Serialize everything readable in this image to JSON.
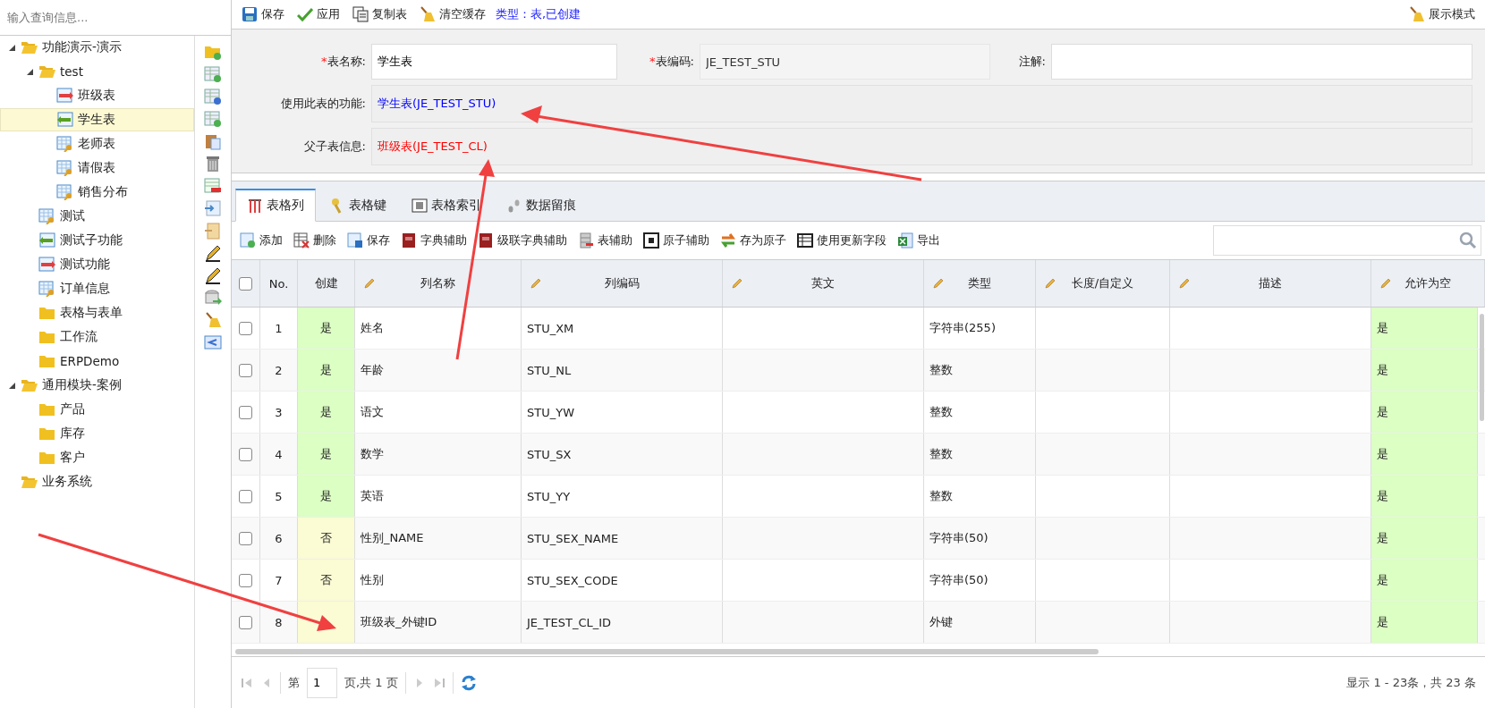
{
  "sidebar": {
    "search": {
      "placeholder": "输入查询信息..."
    },
    "tree": [
      {
        "label": "功能演示-演示",
        "kind": "folder",
        "expanded": true,
        "selected": false,
        "children": [
          {
            "label": "test",
            "kind": "folder",
            "expanded": true,
            "selected": false,
            "children": [
              {
                "label": "班级表",
                "kind": "parent-table",
                "selected": false
              },
              {
                "label": "学生表",
                "kind": "child-table",
                "selected": true
              },
              {
                "label": "老师表",
                "kind": "table",
                "selected": false
              },
              {
                "label": "请假表",
                "kind": "table",
                "selected": false
              },
              {
                "label": "销售分布",
                "kind": "table",
                "selected": false
              }
            ]
          },
          {
            "label": "测试",
            "kind": "table",
            "selected": false
          },
          {
            "label": "测试子功能",
            "kind": "child-table",
            "selected": false
          },
          {
            "label": "测试功能",
            "kind": "parent-table",
            "selected": false
          },
          {
            "label": "订单信息",
            "kind": "table",
            "selected": false
          },
          {
            "label": "表格与表单",
            "kind": "folder",
            "expanded": false,
            "selected": false
          },
          {
            "label": "工作流",
            "kind": "folder",
            "expanded": false,
            "selected": false
          },
          {
            "label": "ERPDemo",
            "kind": "folder",
            "expanded": false,
            "selected": false
          }
        ]
      },
      {
        "label": "通用模块-案例",
        "kind": "folder",
        "expanded": true,
        "selected": false,
        "children": [
          {
            "label": "产品",
            "kind": "folder",
            "expanded": false,
            "selected": false
          },
          {
            "label": "库存",
            "kind": "folder",
            "expanded": false,
            "selected": false
          },
          {
            "label": "客户",
            "kind": "folder",
            "expanded": false,
            "selected": false
          }
        ]
      },
      {
        "label": "业务系统",
        "kind": "folder",
        "expanded": true,
        "selected": false
      }
    ]
  },
  "toolbar": {
    "buttons": [
      {
        "label": "保存",
        "kind": "save"
      },
      {
        "label": "应用",
        "kind": "apply"
      },
      {
        "label": "复制表",
        "kind": "copy"
      },
      {
        "label": "清空缓存",
        "kind": "clear"
      }
    ],
    "status": "类型：表,已创建",
    "mode_button": "展示模式"
  },
  "form": {
    "fields": [
      {
        "required_mark": "*",
        "label": "表名称:",
        "value": "学生表",
        "readonly": false
      },
      {
        "required_mark": "*",
        "label": "表编码:",
        "value": "JE_TEST_STU",
        "readonly": true
      },
      {
        "label": "注解:"
      }
    ],
    "info": [
      {
        "label": "使用此表的功能:",
        "value": "学生表(JE_TEST_STU)",
        "color": "#0000ff"
      },
      {
        "label": "父子表信息:",
        "value": "班级表(JE_TEST_CL)",
        "color": "#ff0000"
      }
    ]
  },
  "tabs": [
    {
      "label": "表格列",
      "selected": true,
      "kind": "columns"
    },
    {
      "label": "表格键",
      "selected": false,
      "kind": "keys"
    },
    {
      "label": "表格索引",
      "selected": false,
      "kind": "index"
    },
    {
      "label": "数据留痕",
      "selected": false,
      "kind": "trace"
    }
  ],
  "grid_toolbar": [
    {
      "label": "添加",
      "kind": "add"
    },
    {
      "label": "删除",
      "kind": "delete"
    },
    {
      "label": "保存",
      "kind": "save"
    },
    {
      "label": "字典辅助",
      "kind": "book"
    },
    {
      "label": "级联字典辅助",
      "kind": "book"
    },
    {
      "label": "表辅助",
      "kind": "db"
    },
    {
      "label": "原子辅助",
      "kind": "atom"
    },
    {
      "label": "存为原子",
      "kind": "swap"
    },
    {
      "label": "使用更新字段",
      "kind": "grid"
    },
    {
      "label": "导出",
      "kind": "excel"
    }
  ],
  "table": {
    "all_checked": false,
    "columns": [
      {
        "label": "No.",
        "editable": false
      },
      {
        "label": "创建",
        "editable": false
      },
      {
        "label": "列名称",
        "editable": true
      },
      {
        "label": "列编码",
        "editable": true
      },
      {
        "label": "英文",
        "editable": true
      },
      {
        "label": "类型",
        "editable": true
      },
      {
        "label": "长度/自定义",
        "editable": true
      },
      {
        "label": "描述",
        "editable": true
      },
      {
        "label": "允许为空",
        "editable": true
      }
    ],
    "rows": [
      {
        "checked": false,
        "no": "1",
        "create": "是",
        "created": true,
        "name": "姓名",
        "code": "STU_XM",
        "type": "字符串(255)",
        "nullable": "是",
        "nullable_on": true
      },
      {
        "checked": false,
        "no": "2",
        "create": "是",
        "created": true,
        "name": "年龄",
        "code": "STU_NL",
        "type": "整数",
        "nullable": "是",
        "nullable_on": true
      },
      {
        "checked": false,
        "no": "3",
        "create": "是",
        "created": true,
        "name": "语文",
        "code": "STU_YW",
        "type": "整数",
        "nullable": "是",
        "nullable_on": true
      },
      {
        "checked": false,
        "no": "4",
        "create": "是",
        "created": true,
        "name": "数学",
        "code": "STU_SX",
        "type": "整数",
        "nullable": "是",
        "nullable_on": true
      },
      {
        "checked": false,
        "no": "5",
        "create": "是",
        "created": true,
        "name": "英语",
        "code": "STU_YY",
        "type": "整数",
        "nullable": "是",
        "nullable_on": true
      },
      {
        "checked": false,
        "no": "6",
        "create": "否",
        "created": false,
        "name": "性别_NAME",
        "code": "STU_SEX_NAME",
        "type": "字符串(50)",
        "nullable": "是",
        "nullable_on": true
      },
      {
        "checked": false,
        "no": "7",
        "create": "否",
        "created": false,
        "name": "性别",
        "code": "STU_SEX_CODE",
        "type": "字符串(50)",
        "nullable": "是",
        "nullable_on": true
      },
      {
        "checked": false,
        "no": "8",
        "created": false,
        "name": "班级表_外键ID",
        "code": "JE_TEST_CL_ID",
        "type": "外键",
        "nullable": "是",
        "nullable_on": true
      }
    ]
  },
  "pager": {
    "before": "第",
    "page": "1",
    "after": "页,共 1 页",
    "summary": "显示 1 - 23条，共 23 条"
  }
}
